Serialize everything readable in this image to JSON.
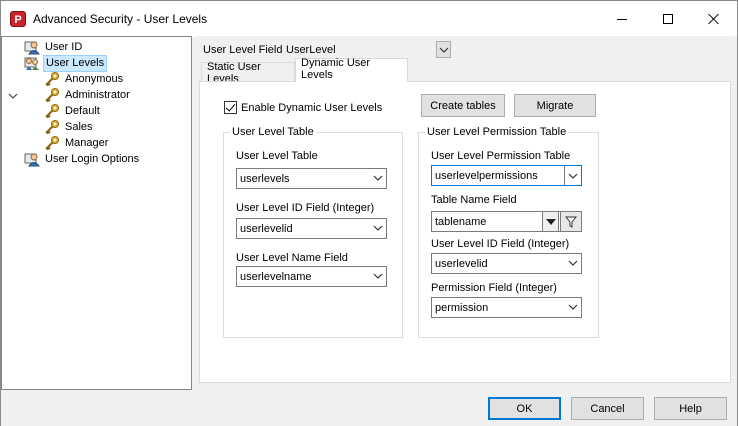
{
  "window": {
    "title": "Advanced Security - User Levels",
    "app_icon_letter": "P"
  },
  "tree": {
    "items": [
      {
        "label": "User ID",
        "icon": "user-id-icon"
      },
      {
        "label": "User Levels",
        "icon": "user-levels-icon",
        "selected": true
      },
      {
        "label": "Anonymous",
        "icon": "key-icon"
      },
      {
        "label": "Administrator",
        "icon": "key-icon"
      },
      {
        "label": "Default",
        "icon": "key-icon"
      },
      {
        "label": "Sales",
        "icon": "key-icon"
      },
      {
        "label": "Manager",
        "icon": "key-icon"
      },
      {
        "label": "User Login Options",
        "icon": "user-login-icon"
      }
    ]
  },
  "header": {
    "field_label": "User Level Field",
    "field_value": "UserLevel"
  },
  "tabs": [
    {
      "label": "Static User Levels",
      "active": false
    },
    {
      "label": "Dynamic User Levels",
      "active": true
    }
  ],
  "dynamic": {
    "enable_label": "Enable Dynamic User Levels",
    "enable_checked": true,
    "create_tables_label": "Create tables",
    "migrate_label": "Migrate",
    "left_group": {
      "title": "User Level Table",
      "table_label": "User Level Table",
      "table_value": "userlevels",
      "id_label": "User Level ID Field (Integer)",
      "id_value": "userlevelid",
      "name_label": "User Level Name Field",
      "name_value": "userlevelname"
    },
    "right_group": {
      "title": "User Level Permission Table",
      "table_label": "User Level Permission Table",
      "table_value": "userlevelpermissions",
      "tablename_label": "Table Name Field",
      "tablename_value": "tablename",
      "id_label": "User Level ID Field (Integer)",
      "id_value": "userlevelid",
      "perm_label": "Permission Field (Integer)",
      "perm_value": "permission"
    }
  },
  "footer": {
    "ok_label": "OK",
    "cancel_label": "Cancel",
    "help_label": "Help"
  },
  "colors": {
    "selection_bg": "#cce8ff",
    "accent": "#0078d7",
    "key_gold": "#d4a017"
  }
}
